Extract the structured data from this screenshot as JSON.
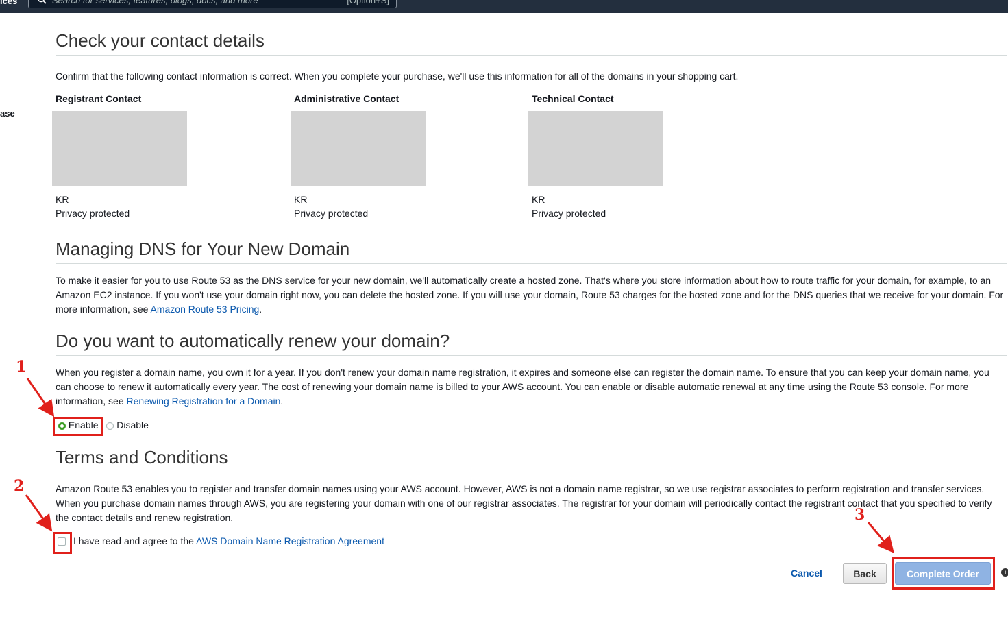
{
  "topbar": {
    "services_fragment": "ices",
    "search_placeholder": "Search for services, features, blogs, docs, and more",
    "search_shortcut": "[Option+S]"
  },
  "left_nav_fragment": "ase",
  "contact_section": {
    "heading": "Check your contact details",
    "description": "Confirm that the following contact information is correct. When you complete your purchase, we'll use this information for all of the domains in your shopping cart.",
    "contacts": [
      {
        "title": "Registrant Contact",
        "country": "KR",
        "status": "Privacy protected"
      },
      {
        "title": "Administrative Contact",
        "country": "KR",
        "status": "Privacy protected"
      },
      {
        "title": "Technical Contact",
        "country": "KR",
        "status": "Privacy protected"
      }
    ]
  },
  "dns_section": {
    "heading": "Managing DNS for Your New Domain",
    "body": "To make it easier for you to use Route 53 as the DNS service for your new domain, we'll automatically create a hosted zone. That's where you store information about how to route traffic for your domain, for example, to an Amazon EC2 instance. If you won't use your domain right now, you can delete the hosted zone. If you will use your domain, Route 53 charges for the hosted zone and for the DNS queries that we receive for your domain. For more information, see ",
    "link": "Amazon Route 53 Pricing",
    "tail": "."
  },
  "renew_section": {
    "heading": "Do you want to automatically renew your domain?",
    "body": "When you register a domain name, you own it for a year. If you don't renew your domain name registration, it expires and someone else can register the domain name. To ensure that you can keep your domain name, you can choose to renew it automatically every year. The cost of renewing your domain name is billed to your AWS account. You can enable or disable automatic renewal at any time using the Route 53 console. For more information, see ",
    "link": "Renewing Registration for a Domain",
    "tail": ".",
    "options": {
      "enable": "Enable",
      "disable": "Disable"
    },
    "selected": "Enable"
  },
  "terms_section": {
    "heading": "Terms and Conditions",
    "body": "Amazon Route 53 enables you to register and transfer domain names using your AWS account. However, AWS is not a domain name registrar, so we use registrar associates to perform registration and transfer services. When you purchase domain names through AWS, you are registering your domain with one of our registrar associates. The registrar for your domain will periodically contact the registrant contact that you specified to verify the contact details and renew registration.",
    "agree_text": "I have read and agree to the ",
    "agree_link": "AWS Domain Name Registration Agreement"
  },
  "actions": {
    "cancel": "Cancel",
    "back": "Back",
    "complete": "Complete Order",
    "info": "i"
  },
  "annotations": {
    "step1": "1",
    "step2": "2",
    "step3": "3",
    "color": "#e0201b"
  }
}
